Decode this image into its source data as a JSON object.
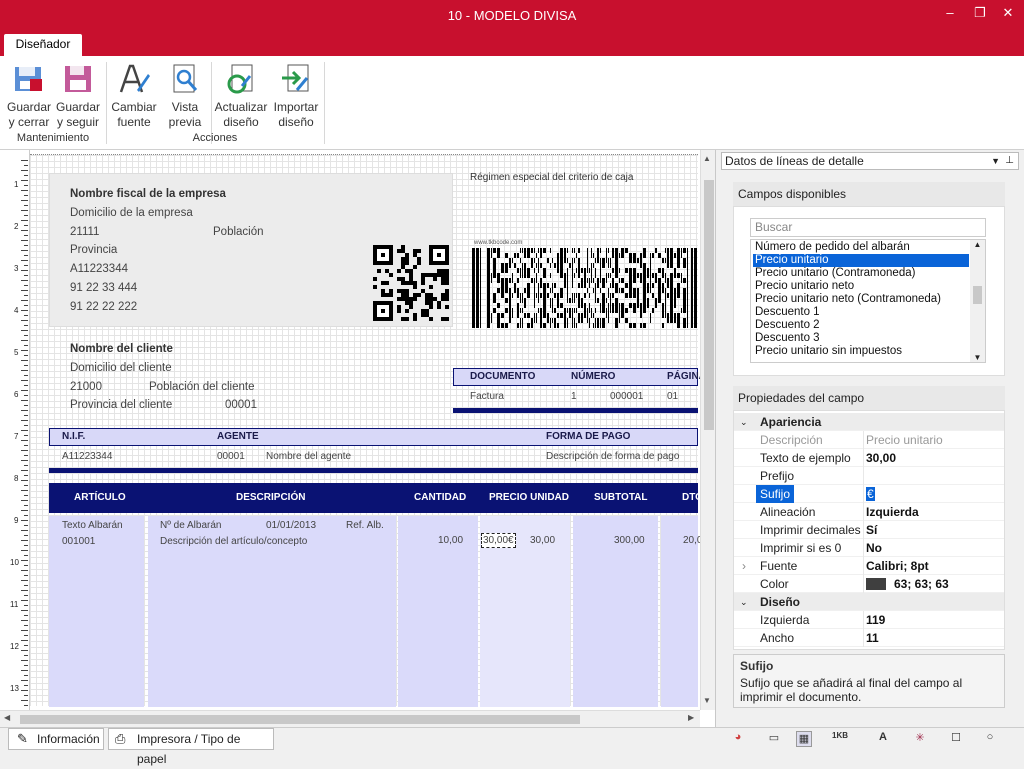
{
  "window": {
    "title": "10 - MODELO DIVISA",
    "minimize": "–",
    "maximize": "❐",
    "close": "✕"
  },
  "ribbon": {
    "tab": "Diseñador",
    "buttons": {
      "save_close": [
        "Guardar",
        "y cerrar"
      ],
      "save_continue": [
        "Guardar",
        "y seguir"
      ],
      "change_font": [
        "Cambiar",
        "fuente"
      ],
      "preview": [
        "Vista",
        "previa"
      ],
      "update_design": [
        "Actualizar",
        "diseño"
      ],
      "import_design": [
        "Importar",
        "diseño"
      ]
    },
    "groups": {
      "maintenance": "Mantenimiento",
      "actions": "Acciones"
    }
  },
  "ruler": [
    "1",
    "2",
    "3",
    "4",
    "5",
    "6",
    "7",
    "8",
    "9",
    "10",
    "11",
    "12",
    "13"
  ],
  "doc": {
    "company": {
      "name": "Nombre fiscal de la empresa",
      "address": "Domicilio de la empresa",
      "zip": "21111",
      "city": "Población",
      "province": "Provincia",
      "nif": "A11223344",
      "phone1": "91 22 33 444",
      "phone2": "91 22 22 222"
    },
    "regime": "Régimen especial del criterio de caja",
    "barcode_caption": "www.tkbcode.com",
    "client": {
      "name": "Nombre del cliente",
      "address": "Domicilio del cliente",
      "zip": "21000",
      "city": "Población del cliente",
      "province": "Provincia del cliente",
      "code": "00001"
    },
    "docbox": {
      "headers": [
        "DOCUMENTO",
        "NÚMERO",
        "PÁGINA"
      ],
      "values": [
        "Factura",
        "1",
        "000001",
        "01"
      ]
    },
    "info": {
      "headers": [
        "N.I.F.",
        "AGENTE",
        "FORMA DE PAGO"
      ],
      "nif": "A11223344",
      "agent_code": "00001",
      "agent_name": "Nombre del agente",
      "payment": "Descripción de forma de pago"
    },
    "lines": {
      "headers": [
        "ARTÍCULO",
        "DESCRIPCIÓN",
        "CANTIDAD",
        "PRECIO UNIDAD",
        "SUBTOTAL",
        "DTO"
      ],
      "article_text": "Texto Albarán",
      "article_code": "001001",
      "albaran_no": "Nº de Albarán",
      "albaran_date": "01/01/2013",
      "ref": "Ref. Alb.",
      "description": "Descripción del artículo/concepto",
      "quantity": "10,00",
      "price_selected": "30,00€",
      "price": "30,00",
      "subtotal": "300,00",
      "discount": "20,0"
    }
  },
  "bottom_tabs": {
    "info": "Información",
    "printer": "Impresora / Tipo de papel"
  },
  "panel": {
    "combo": "Datos de líneas de detalle",
    "available_title": "Campos disponibles",
    "search_placeholder": "Buscar",
    "fields": [
      "Número de pedido del albarán",
      "Precio unitario",
      "Precio unitario  (Contramoneda)",
      "Precio unitario neto",
      "Precio unitario neto (Contramoneda)",
      "Descuento 1",
      "Descuento 2",
      "Descuento 3",
      "Precio unitario sin impuestos"
    ],
    "selected_field": 1,
    "props_title": "Propiedades del campo",
    "cat_appearance": "Apariencia",
    "cat_design": "Diseño",
    "props": {
      "description": {
        "label": "Descripción",
        "value": "Precio unitario"
      },
      "sample": {
        "label": "Texto de ejemplo",
        "value": "30,00"
      },
      "prefix": {
        "label": "Prefijo",
        "value": ""
      },
      "suffix": {
        "label": "Sufijo",
        "value": "€"
      },
      "align": {
        "label": "Alineación",
        "value": "Izquierda"
      },
      "decimals": {
        "label": "Imprimir decimales",
        "value": "Sí"
      },
      "zero": {
        "label": "Imprimir si es 0",
        "value": "No"
      },
      "font": {
        "label": "Fuente",
        "value": "Calibri; 8pt"
      },
      "color": {
        "label": "Color",
        "value": "63; 63; 63"
      },
      "left": {
        "label": "Izquierda",
        "value": "119"
      },
      "width": {
        "label": "Ancho",
        "value": "11"
      }
    },
    "help_title": "Sufijo",
    "help_text": [
      "Sufijo que se añadirá al final del campo al",
      "imprimir el documento."
    ]
  },
  "colors": {
    "brand": "#c8102e",
    "navy": "#0a1273",
    "lightpurple": "#d8d8f8",
    "selection": "#0a64d8"
  }
}
